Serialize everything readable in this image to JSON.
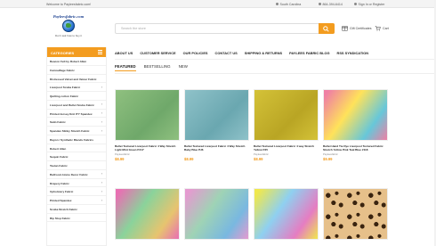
{
  "topbar": {
    "welcome": "Welcome to Payleesfabric.com!",
    "location": "South Carolina",
    "phone": "864-394-6414",
    "account": "Sign In or Register"
  },
  "logo": {
    "brand": "Payleesfabric.com",
    "tagline": "Don't ask how to buy it"
  },
  "search": {
    "placeholder": "Search the store"
  },
  "header": {
    "gift": "Gift Certificates",
    "cart": "Cart"
  },
  "sidebar": {
    "title": "CATEGORIES",
    "items": [
      {
        "label": "Beacon Felt by Robert Allen",
        "arrow": ""
      },
      {
        "label": "Camouflage Fabric",
        "arrow": ""
      },
      {
        "label": "Distressed Velvet and Velour Fabric",
        "arrow": ""
      },
      {
        "label": "Liverpool Scuba Fabric",
        "arrow": "›"
      },
      {
        "label": "Quilting cotton Fabric",
        "arrow": ""
      },
      {
        "label": "Liverpool and Bullet Scuba Fabric",
        "arrow": "›"
      },
      {
        "label": "Printed Jersey Knit ITY Spandex",
        "arrow": "›"
      },
      {
        "label": "Satin Fabric",
        "arrow": "›"
      },
      {
        "label": "Spandex Slinky Stretch Fabric",
        "arrow": "›"
      },
      {
        "label": "Rayon / Synthetic Blends Fabrics",
        "arrow": ""
      },
      {
        "label": "Robert Allen",
        "arrow": ""
      },
      {
        "label": "Sequin Fabric",
        "arrow": ""
      },
      {
        "label": "Taslan Fabric",
        "arrow": ""
      },
      {
        "label": "Ballroom Home Decor Fabric",
        "arrow": "›"
      },
      {
        "label": "Drapery Fabric",
        "arrow": "›"
      },
      {
        "label": "Upholstery Fabric",
        "arrow": "›"
      },
      {
        "label": "Printed Spandex",
        "arrow": "›"
      },
      {
        "label": "Scuba Stretch Fabric",
        "arrow": ""
      },
      {
        "label": "Rip Stop Fabric",
        "arrow": ""
      }
    ]
  },
  "nav": [
    "ABOUT US",
    "CUSTOMER SERVICE",
    "OUR POLICIES",
    "CONTACT US",
    "SHIPPING & RETURNS",
    "PAYLEES FABRIC BLOG",
    "RSS SYNDICATION"
  ],
  "tabs": [
    "FEATURED",
    "BESTSELLING",
    "NEW"
  ],
  "products": [
    {
      "title": "Bullet Textured Liverpool Fabric 4 Way Stretch Light Mint Green PJ17",
      "brand": "Payleesfabric",
      "price": "$8.99",
      "colors": [
        "#8fc07f",
        "#6fa86a"
      ]
    },
    {
      "title": "Bullet Textured Liverpool Fabric 4 Way Stretch Baby Blue PJ6",
      "brand": "",
      "price": "$8.99",
      "colors": [
        "#8fc2c9",
        "#6aa7b0"
      ]
    },
    {
      "title": "Bullet Textured Liverpool Fabric 4 way Stretch Yellow PJ5",
      "brand": "Payleesfabric",
      "price": "$8.99",
      "colors": [
        "#d4c238",
        "#b9a524"
      ]
    },
    {
      "title": "Bullet Hand Tie Dye Liverpool Textured Fabric Stretch Yellow Pink Teal Blue #118",
      "brand": "Payleesfabric",
      "price": "$9.99",
      "colors": [
        "#ef7fa4",
        "#ffe25a",
        "#67c7d9"
      ]
    },
    {
      "title": "",
      "brand": "",
      "price": "",
      "colors": [
        "#e96fb3",
        "#8ad39b",
        "#e7c46f"
      ]
    },
    {
      "title": "",
      "brand": "",
      "price": "",
      "colors": [
        "#e59ad0",
        "#9fd3b5",
        "#79b8e0"
      ]
    },
    {
      "title": "",
      "brand": "",
      "price": "",
      "colors": [
        "#f0e84d",
        "#8fd0f0",
        "#e57dc2"
      ]
    },
    {
      "title": "",
      "brand": "",
      "price": "",
      "colors": [
        "#e6c08a",
        "#3a2410",
        "#c8955a"
      ]
    }
  ],
  "colors": {
    "accent": "#f39c1f"
  }
}
